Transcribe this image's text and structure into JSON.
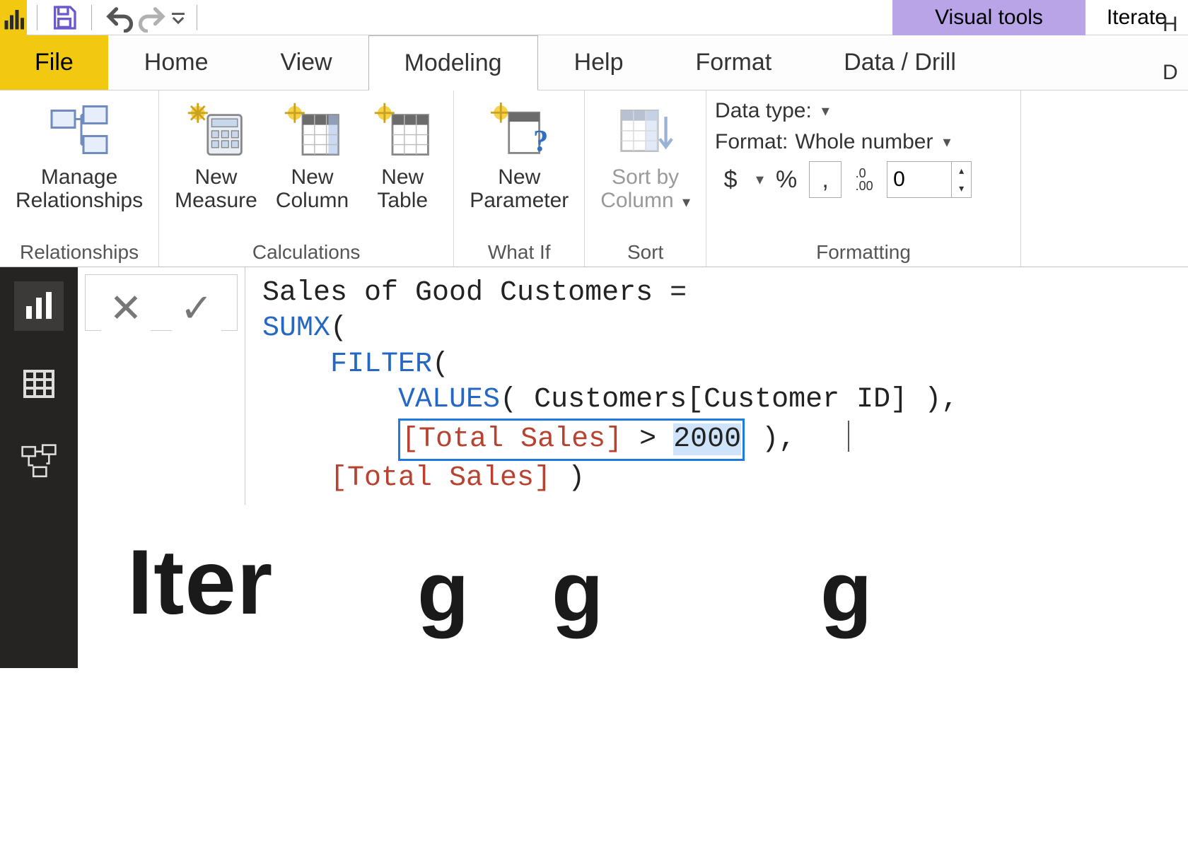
{
  "qat": {
    "contextual_tab": "Visual tools",
    "doc_title": "Iterate"
  },
  "tabs": {
    "file": "File",
    "home": "Home",
    "view": "View",
    "modeling": "Modeling",
    "help": "Help",
    "format": "Format",
    "datadrill": "Data / Drill"
  },
  "ribbon": {
    "relationships": {
      "manage": "Manage\nRelationships",
      "group": "Relationships"
    },
    "calculations": {
      "new_measure": "New\nMeasure",
      "new_column": "New\nColumn",
      "new_table": "New\nTable",
      "group": "Calculations"
    },
    "whatif": {
      "new_parameter": "New\nParameter",
      "group": "What If"
    },
    "sort": {
      "sort_by_column": "Sort by\nColumn",
      "group": "Sort"
    },
    "formatting": {
      "data_type_label": "Data type:",
      "format_label": "Format:",
      "format_value": "Whole number",
      "currency": "$",
      "percent": "%",
      "thousands": ",",
      "decimals_icon": ".0\n.00",
      "decimals_value": "0",
      "group": "Formatting",
      "partial": "H\n\nD"
    }
  },
  "formula": {
    "line1_name": "Sales of Good Customers =",
    "sumx": "SUMX",
    "filter": "FILTER",
    "values": "VALUES",
    "col_ref": "Customers[Customer ID]",
    "total_sales": "[Total Sales]",
    "gt": ">",
    "threshold": "2000",
    "paren_open": "(",
    "paren_close": ")",
    "comma": ","
  },
  "canvas": {
    "big": "Iter"
  }
}
